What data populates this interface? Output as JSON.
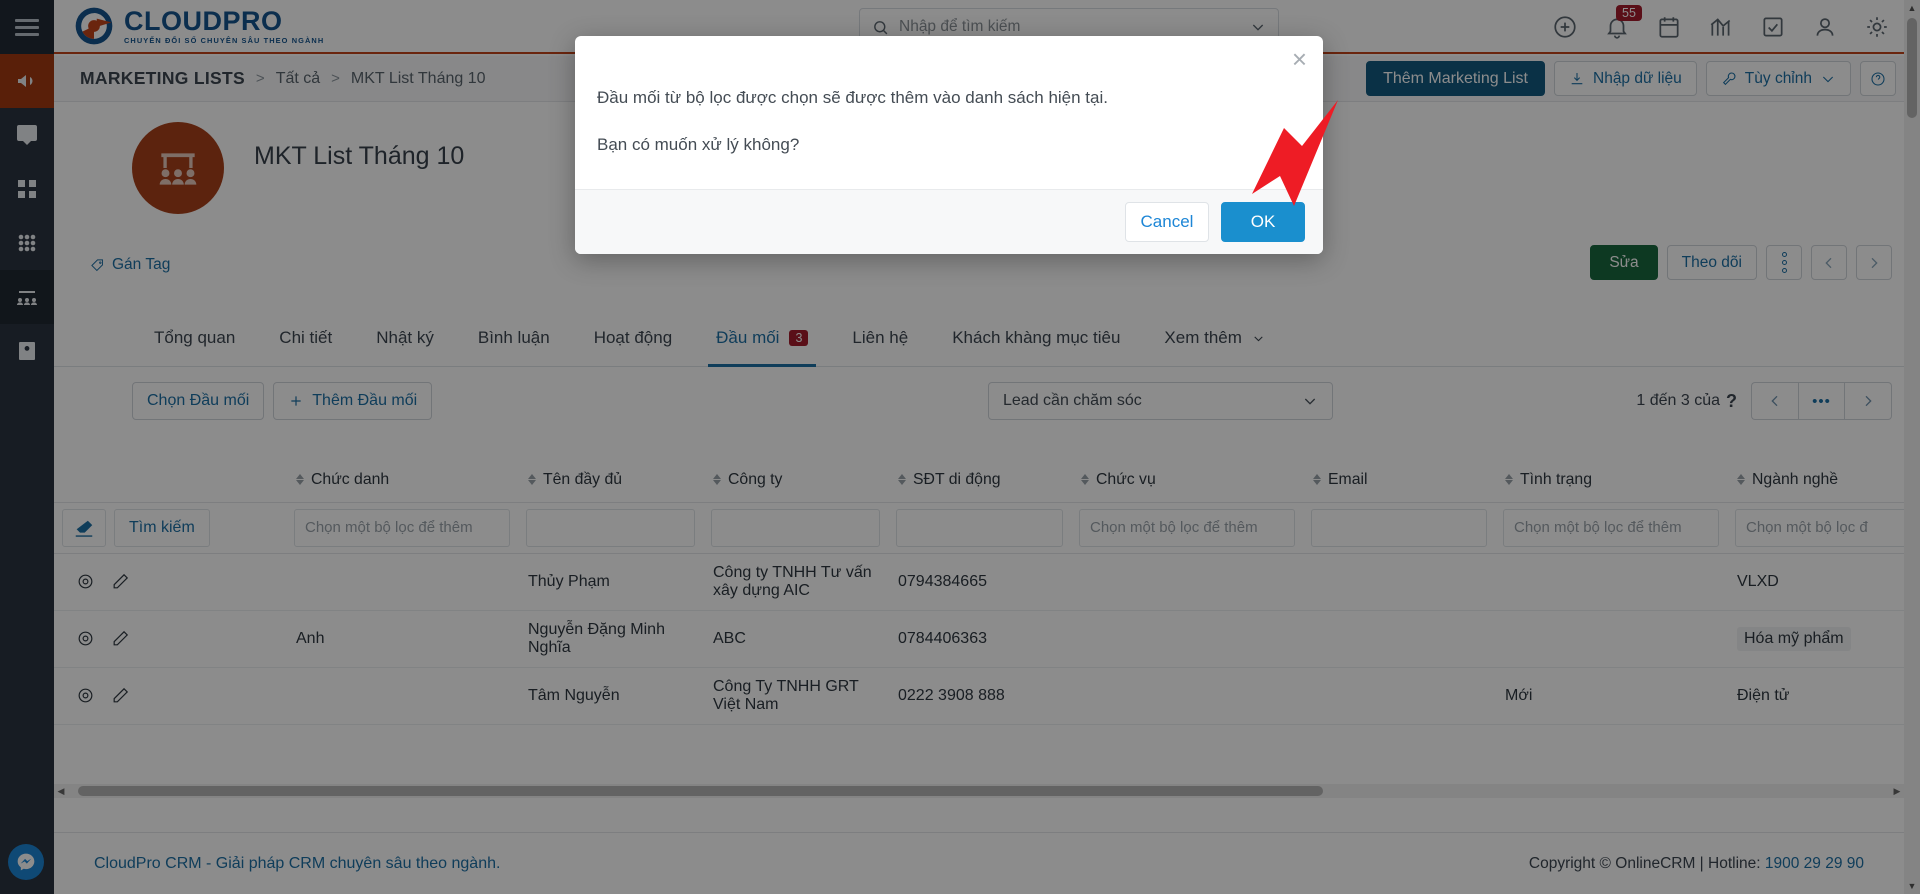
{
  "app": {
    "logo_name": "CLOUDPRO",
    "logo_tagline": "CHUYỂN ĐỔI SỐ CHUYÊN SÂU THEO NGÀNH"
  },
  "search": {
    "placeholder": "Nhập để tìm kiếm"
  },
  "topbar": {
    "notification_count": "55",
    "icons": [
      "plus-circle-icon",
      "bell-icon",
      "calendar-icon",
      "chart-icon",
      "task-check-icon",
      "user-icon",
      "gear-icon"
    ]
  },
  "breadcrumb": {
    "module": "MARKETING LISTS",
    "sep": ">",
    "parent": "Tất cả",
    "current": "MKT List Tháng 10"
  },
  "crumb_actions": {
    "add_list": "Thêm Marketing List",
    "import": "Nhập dữ liệu",
    "customize": "Tùy chỉnh",
    "help": "?"
  },
  "record": {
    "title": "MKT List Tháng 10",
    "tag_link": "Gán Tag",
    "edit": "Sửa",
    "follow": "Theo dõi"
  },
  "tabs": [
    {
      "label": "Tổng quan",
      "count": null,
      "active": false
    },
    {
      "label": "Chi tiết",
      "count": null,
      "active": false
    },
    {
      "label": "Nhật ký",
      "count": null,
      "active": false
    },
    {
      "label": "Bình luận",
      "count": null,
      "active": false
    },
    {
      "label": "Hoạt động",
      "count": null,
      "active": false
    },
    {
      "label": "Đầu mối",
      "count": "3",
      "active": true
    },
    {
      "label": "Liên hệ",
      "count": null,
      "active": false
    },
    {
      "label": "Khách khàng mục tiêu",
      "count": null,
      "active": false
    },
    {
      "label": "Xem thêm",
      "count": null,
      "active": false,
      "chevron": true
    }
  ],
  "subbar": {
    "select_lead": "Chọn Đầu mối",
    "add_lead": "Thêm Đầu mối",
    "filter_select": "Lead cần chăm sóc",
    "pager_text": "1 đến 3 của",
    "pager_unknown": "?",
    "pager_more": "•••"
  },
  "table": {
    "search_button": "Tìm kiếm",
    "filter_placeholder": "Chọn một bộ lọc để thêm",
    "filter_placeholder_short": "Chọn một bộ lọc",
    "columns": [
      {
        "label": "",
        "sortable": false
      },
      {
        "label": "Chức danh",
        "sortable": true
      },
      {
        "label": "Tên đầy đủ",
        "sortable": true
      },
      {
        "label": "Công ty",
        "sortable": true
      },
      {
        "label": "SĐT di động",
        "sortable": true
      },
      {
        "label": "Chức vụ",
        "sortable": true
      },
      {
        "label": "Email",
        "sortable": true
      },
      {
        "label": "Tình trạng",
        "sortable": true
      },
      {
        "label": "Ngành nghề",
        "sortable": true
      }
    ],
    "filters": [
      "",
      "Chọn một bộ lọc để thêm",
      "",
      "",
      "",
      "Chọn một bộ lọc để thêm",
      "",
      "Chọn một bộ lọc để thêm",
      "Chọn một bộ lọc đ"
    ],
    "rows": [
      {
        "chuc_danh": "",
        "ten_day_du": "Thủy Phạm",
        "cong_ty": "Công ty TNHH Tư vấn xây dựng AIC",
        "sdt": "0794384665",
        "chuc_vu": "",
        "email": "",
        "tinh_trang": "",
        "nganh_nghe": "VLXD"
      },
      {
        "chuc_danh": "Anh",
        "ten_day_du": "Nguyễn Đặng Minh Nghĩa",
        "cong_ty": "ABC",
        "sdt": "0784406363",
        "chuc_vu": "",
        "email": "",
        "tinh_trang": "",
        "nganh_nghe": "Hóa mỹ phẩm"
      },
      {
        "chuc_danh": "",
        "ten_day_du": "Tâm Nguyễn",
        "cong_ty": "Công Ty TNHH GRT Việt Nam",
        "sdt": "0222 3908 888",
        "chuc_vu": "",
        "email": "",
        "tinh_trang": "Mới",
        "nganh_nghe": "Điện tử"
      }
    ]
  },
  "modal": {
    "line1": "Đầu mối từ bộ lọc được chọn sẽ được thêm vào danh sách hiện tại.",
    "line2": "Bạn có muốn xử lý không?",
    "cancel": "Cancel",
    "ok": "OK",
    "close_icon": "×"
  },
  "footer": {
    "left": "CloudPro CRM - Giải pháp CRM chuyên sâu theo ngành.",
    "copyright": "Copyright © OnlineCRM | Hotline: ",
    "hotline": "1900 29 29 90"
  },
  "colors": {
    "brand_blue": "#14558f",
    "brand_orange": "#c1441a",
    "accent_link": "#1d6fa5",
    "primary_btn": "#135a80",
    "ok_btn": "#1a8fce",
    "green_btn": "#19683f",
    "badge_red": "#a51d2d",
    "arrow_red": "#ee1c25"
  }
}
